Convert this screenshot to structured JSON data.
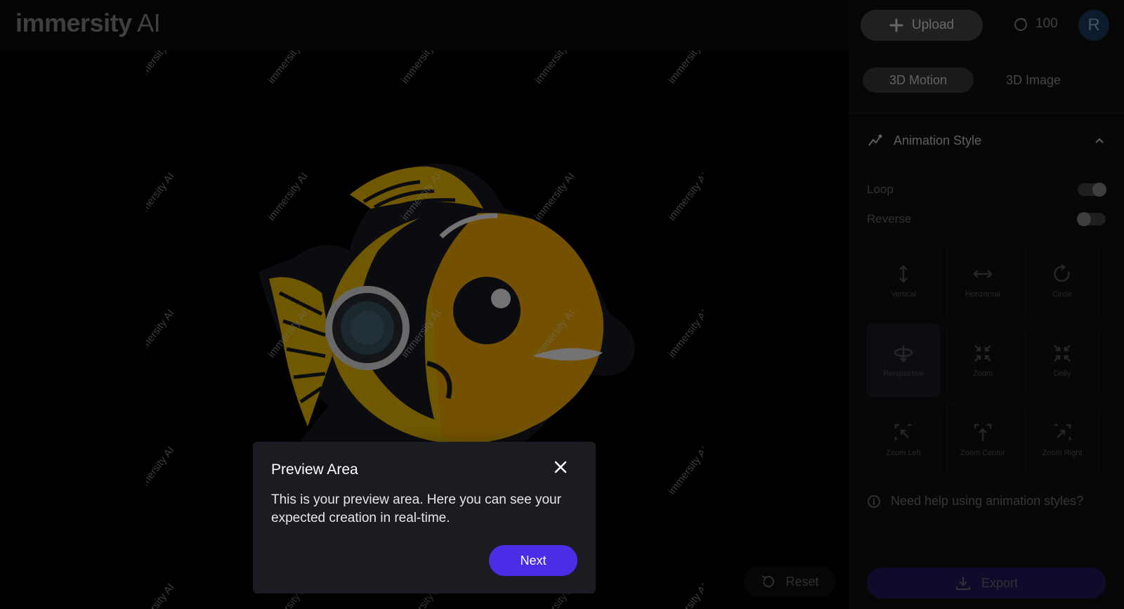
{
  "app": {
    "logo_main": "immersity",
    "logo_suffix": " AI"
  },
  "header": {
    "upload_label": "Upload",
    "credits": "100",
    "avatar_initial": "R"
  },
  "tabs": [
    {
      "label": "3D Motion",
      "active": true
    },
    {
      "label": "3D Image",
      "active": false
    }
  ],
  "animation": {
    "section_title": "Animation Style",
    "loop_label": "Loop",
    "loop_on": true,
    "reverse_label": "Reverse",
    "reverse_on": false,
    "styles": [
      {
        "label": "Vertical",
        "icon": "vertical-arrows-icon",
        "selected": false
      },
      {
        "label": "Horizontal",
        "icon": "horizontal-arrows-icon",
        "selected": false
      },
      {
        "label": "Circle",
        "icon": "circle-arrow-icon",
        "selected": false
      },
      {
        "label": "Perspective",
        "icon": "perspective-icon",
        "selected": true
      },
      {
        "label": "Zoom",
        "icon": "zoom-icon",
        "selected": false
      },
      {
        "label": "Dolly",
        "icon": "dolly-icon",
        "selected": false
      },
      {
        "label": "Zoom Left",
        "icon": "zoom-left-icon",
        "selected": false
      },
      {
        "label": "Zoom Center",
        "icon": "zoom-center-icon",
        "selected": false
      },
      {
        "label": "Zoom Right",
        "icon": "zoom-right-icon",
        "selected": false
      }
    ],
    "help_text": "Need help using animation styles?"
  },
  "actions": {
    "reset_label": "Reset",
    "export_label": "Export"
  },
  "preview": {
    "watermark_text": "immersity AI"
  },
  "popup": {
    "title": "Preview Area",
    "body": "This is your preview area. Here you can see your expected creation in real-time.",
    "next_label": "Next"
  },
  "colors": {
    "accent": "#4a2ee6",
    "fish_yellow": "#f7c400",
    "fish_dark": "#1a1c24",
    "avatar_bg": "#1c3d66"
  }
}
